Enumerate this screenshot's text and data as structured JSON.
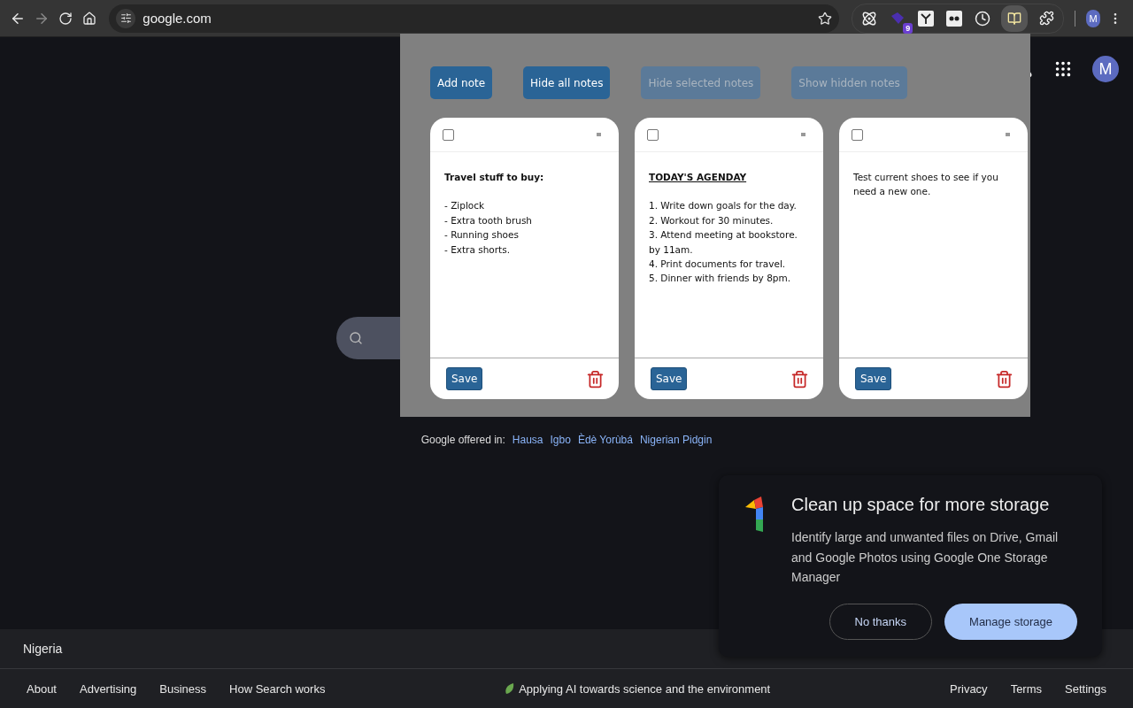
{
  "browser": {
    "address": "google.com",
    "extension_badge": "9",
    "profile_initial": "M"
  },
  "google": {
    "avatar_initial": "M",
    "offered_in_label": "Google offered in:",
    "languages": [
      "Hausa",
      "Igbo",
      "Èdè Yorùbá",
      "Nigerian Pidgin"
    ],
    "footer": {
      "country": "Nigeria",
      "left_links": [
        "About",
        "Advertising",
        "Business",
        "How Search works"
      ],
      "center_link": "Applying AI towards science and the environment",
      "right_links": [
        "Privacy",
        "Terms",
        "Settings"
      ]
    }
  },
  "notes_popup": {
    "buttons": [
      {
        "label": "Add note",
        "disabled": false
      },
      {
        "label": "Hide all notes",
        "disabled": false
      },
      {
        "label": "Hide selected notes",
        "disabled": true
      },
      {
        "label": "Show hidden notes",
        "disabled": true
      }
    ],
    "notes": [
      {
        "checked": false,
        "title": "Travel stuff to buy:",
        "title_underlined": false,
        "lines": [
          "- Ziplock",
          "- Extra tooth brush",
          "- Running shoes",
          "- Extra shorts."
        ],
        "save_label": "Save"
      },
      {
        "checked": false,
        "title": "TODAY'S AGENDAY",
        "title_underlined": true,
        "lines": [
          "1. Write down goals for the day.",
          "2. Workout for 30 minutes.",
          "3. Attend meeting at bookstore.",
          "by 11am.",
          "4. Print documents for travel.",
          "5. Dinner with friends by 8pm."
        ],
        "save_label": "Save"
      },
      {
        "checked": false,
        "lines": [
          "Test current shoes to see if you need a new one."
        ],
        "save_label": "Save"
      }
    ]
  },
  "storage_prompt": {
    "title": "Clean up space for more storage",
    "body": "Identify large and unwanted files on Drive, Gmail and Google Photos using Google One Storage Manager",
    "dismiss": "No thanks",
    "confirm": "Manage storage"
  }
}
